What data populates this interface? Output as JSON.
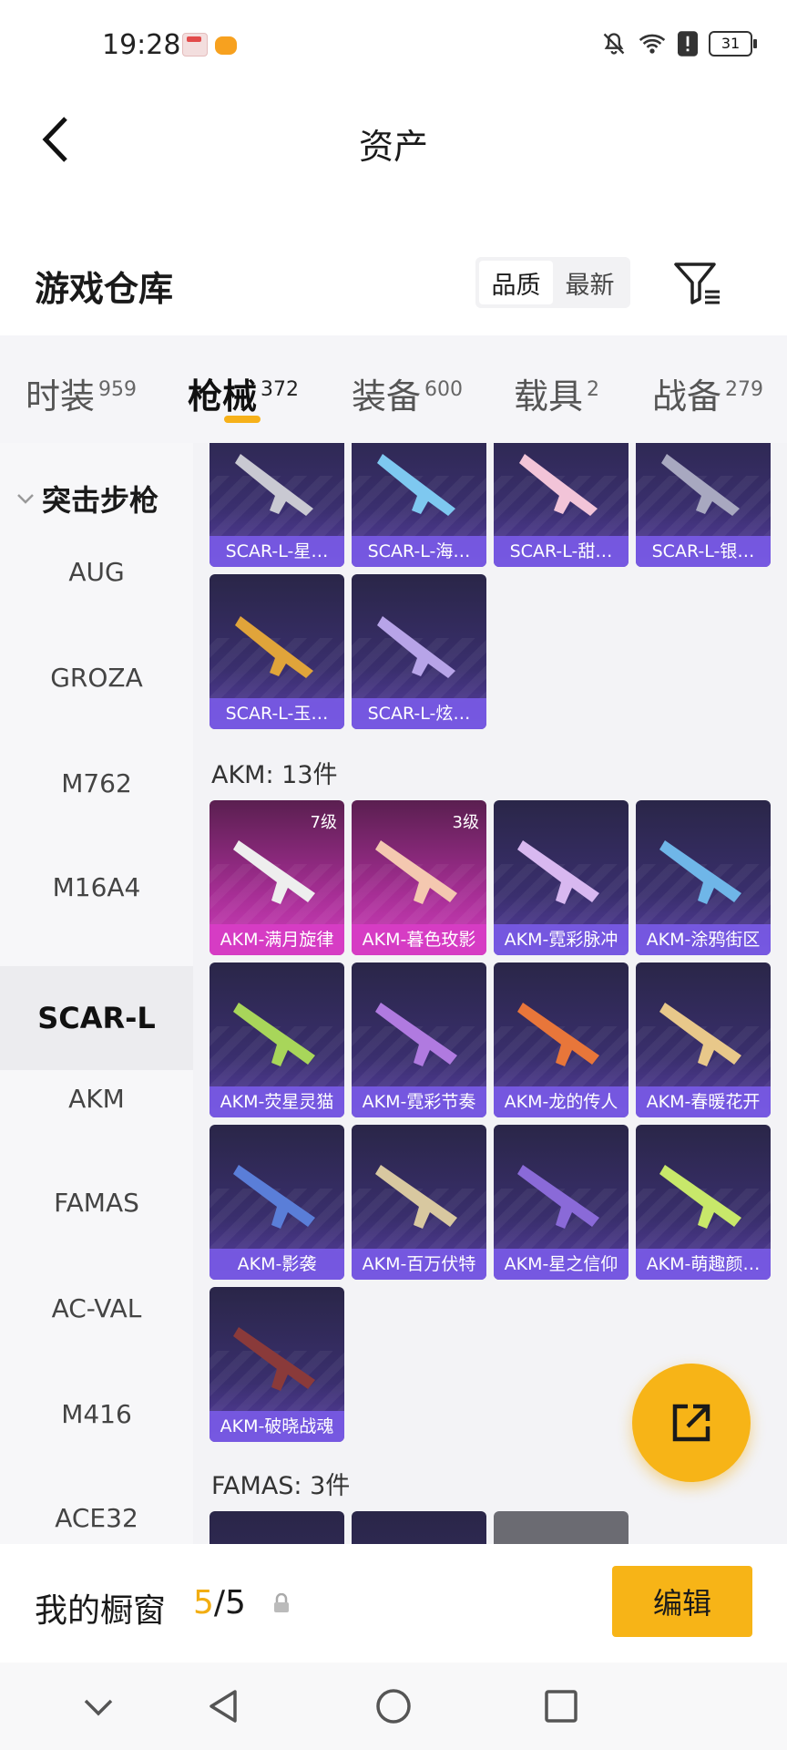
{
  "status_bar": {
    "time": "19:28",
    "battery": "31"
  },
  "header": {
    "title": "资产"
  },
  "section": {
    "title": "游戏仓库",
    "sort_quality": "品质",
    "sort_newest": "最新"
  },
  "tabs": [
    {
      "label": "时装",
      "count": "959"
    },
    {
      "label": "枪械",
      "count": "372"
    },
    {
      "label": "装备",
      "count": "600"
    },
    {
      "label": "载具",
      "count": "2"
    },
    {
      "label": "战备",
      "count": "279"
    }
  ],
  "sidebar": {
    "group": "突击步枪",
    "items": [
      "AUG",
      "GROZA",
      "M762",
      "M16A4",
      "SCAR-L",
      "AKM",
      "FAMAS",
      "AC-VAL",
      "M416",
      "ACE32"
    ]
  },
  "scar_items": [
    "SCAR-L-星…",
    "SCAR-L-海…",
    "SCAR-L-甜…",
    "SCAR-L-银…",
    "SCAR-L-玉…",
    "SCAR-L-炫…"
  ],
  "akm_group": {
    "title": "AKM: 13件"
  },
  "akm_items": [
    {
      "name": "AKM-满月旋律",
      "level": "7级"
    },
    {
      "name": "AKM-暮色玫影",
      "level": "3级"
    },
    {
      "name": "AKM-霓彩脉冲"
    },
    {
      "name": "AKM-涂鸦街区"
    },
    {
      "name": "AKM-荧星灵猫"
    },
    {
      "name": "AKM-霓彩节奏"
    },
    {
      "name": "AKM-龙的传人"
    },
    {
      "name": "AKM-春暖花开"
    },
    {
      "name": "AKM-影袭"
    },
    {
      "name": "AKM-百万伏特"
    },
    {
      "name": "AKM-星之信仰"
    },
    {
      "name": "AKM-萌趣颜…"
    },
    {
      "name": "AKM-破晓战魂"
    }
  ],
  "famas_group": {
    "title": "FAMAS: 3件"
  },
  "showcase": {
    "label": "我的橱窗",
    "current": "5",
    "total": "/5",
    "edit": "编辑"
  },
  "colors": {
    "accent": "#f7b417",
    "card_purple": "#7a5ae6",
    "card_pink": "#d63cc4"
  }
}
